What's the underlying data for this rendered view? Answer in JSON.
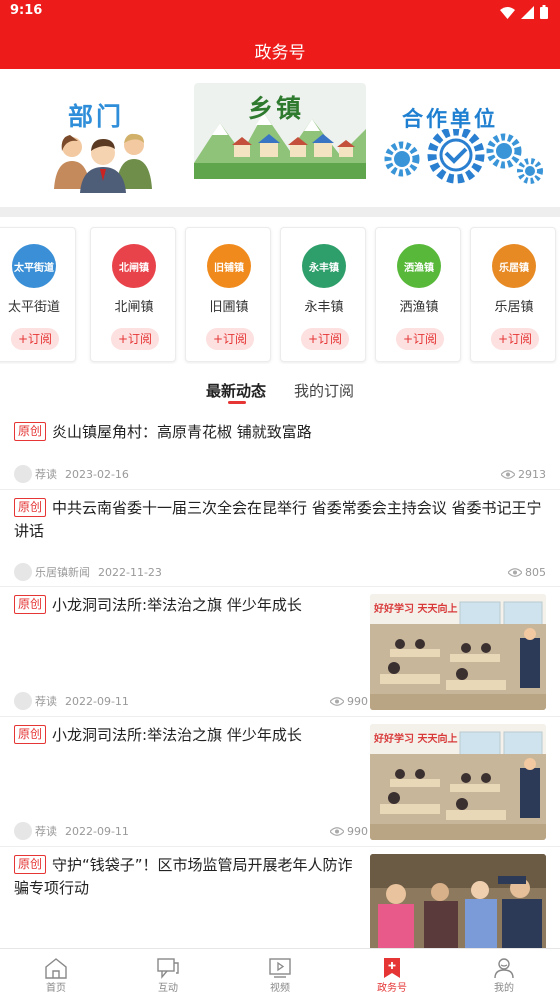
{
  "status_bar": {
    "time": "9:16"
  },
  "header": {
    "title": "政务号"
  },
  "categories": [
    {
      "label": "部门",
      "icon": "people-icon"
    },
    {
      "label": "乡镇",
      "icon": "mountain-village-icon"
    },
    {
      "label": "合作单位",
      "icon": "gears-handshake-icon"
    }
  ],
  "towns": [
    {
      "name": "太平街道",
      "logo_text": "太平街道",
      "color": "#3a8fd6",
      "subscribe": "+订阅"
    },
    {
      "name": "北闸镇",
      "logo_text": "北闸镇",
      "color": "#e8434a",
      "subscribe": "+订阅"
    },
    {
      "name": "旧圃镇",
      "logo_text": "旧铺镇",
      "color": "#f08a1c",
      "subscribe": "+订阅"
    },
    {
      "name": "永丰镇",
      "logo_text": "永丰镇",
      "color": "#2e9e6a",
      "subscribe": "+订阅"
    },
    {
      "name": "洒渔镇",
      "logo_text": "洒渔镇",
      "color": "#58b83a",
      "subscribe": "+订阅"
    },
    {
      "name": "乐居镇",
      "logo_text": "乐居镇",
      "color": "#e78a24",
      "subscribe": "+订阅"
    }
  ],
  "tabs": [
    {
      "label": "最新动态",
      "active": true
    },
    {
      "label": "我的订阅",
      "active": false
    }
  ],
  "news": [
    {
      "badge": "原创",
      "title": "炎山镇屋角村：高原青花椒 铺就致富路",
      "source": "荐读",
      "date": "2023-02-16",
      "views": "2913",
      "has_image": false
    },
    {
      "badge": "原创",
      "title": "中共云南省委十一届三次全会在昆举行 省委常委会主持会议 省委书记王宁讲话",
      "source": "乐居镇新闻",
      "date": "2022-11-23",
      "views": "805",
      "has_image": false
    },
    {
      "badge": "原创",
      "title": "小龙洞司法所:举法治之旗 伴少年成长",
      "source": "荐读",
      "date": "2022-09-11",
      "views": "990",
      "has_image": true,
      "image_text": "好好学习 天天向上"
    },
    {
      "badge": "原创",
      "title": "小龙洞司法所:举法治之旗 伴少年成长",
      "source": "荐读",
      "date": "2022-09-11",
      "views": "990",
      "has_image": true,
      "image_text": "好好学习 天天向上"
    },
    {
      "badge": "原创",
      "title": "守护“钱袋子”！区市场监管局开展老年人防诈骗专项行动",
      "has_image": true
    }
  ],
  "bottom_nav": [
    {
      "label": "首页",
      "icon": "home-icon",
      "active": false
    },
    {
      "label": "互动",
      "icon": "chat-icon",
      "active": false
    },
    {
      "label": "视频",
      "icon": "video-icon",
      "active": false
    },
    {
      "label": "政务号",
      "icon": "bookmark-plus-icon",
      "active": true
    },
    {
      "label": "我的",
      "icon": "user-icon",
      "active": false
    }
  ]
}
